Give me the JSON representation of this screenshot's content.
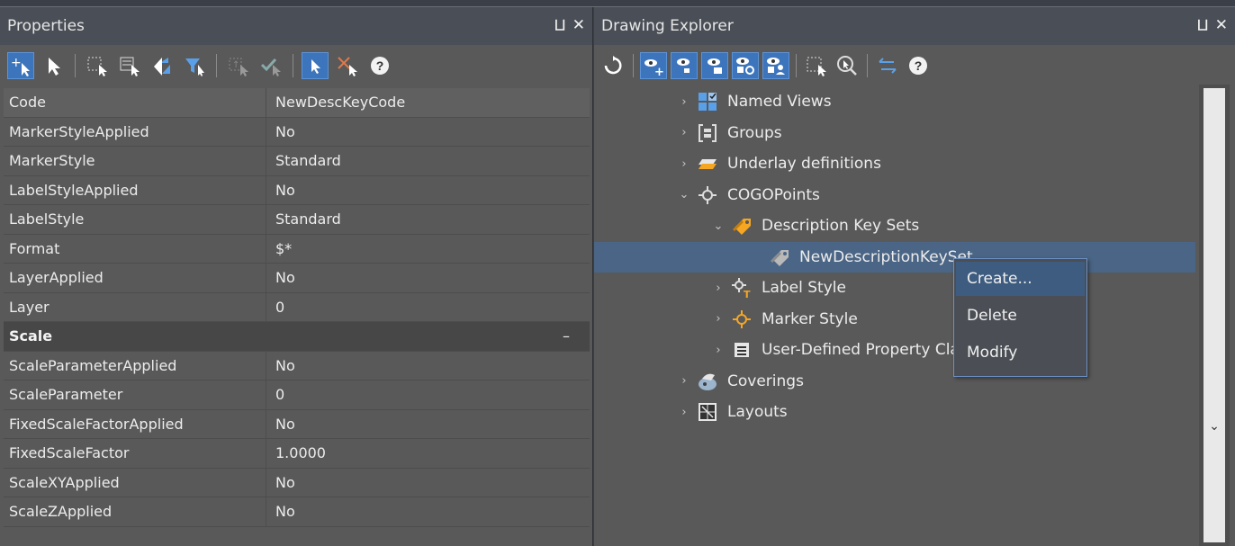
{
  "properties": {
    "title": "Properties",
    "pin_glyph": "⊥",
    "close_glyph": "✕",
    "toolbar_icons": [
      "add-select-icon",
      "pointer-icon",
      "select-window-icon",
      "select-crossing-icon",
      "swap-icon",
      "filter-icon",
      "pick-add-icon",
      "pick-check-icon",
      "select-object-icon",
      "remove-x-icon",
      "help-icon"
    ],
    "rows": [
      {
        "key": "Code",
        "value": "NewDescKeyCode"
      },
      {
        "key": "MarkerStyleApplied",
        "value": "No"
      },
      {
        "key": "MarkerStyle",
        "value": "Standard"
      },
      {
        "key": "LabelStyleApplied",
        "value": "No"
      },
      {
        "key": "LabelStyle",
        "value": "Standard"
      },
      {
        "key": "Format",
        "value": "$*"
      },
      {
        "key": "LayerApplied",
        "value": "No"
      },
      {
        "key": "Layer",
        "value": "0"
      }
    ],
    "section": {
      "label": "Scale",
      "toggle": "–"
    },
    "scale_rows": [
      {
        "key": "ScaleParameterApplied",
        "value": "No"
      },
      {
        "key": "ScaleParameter",
        "value": "0"
      },
      {
        "key": "FixedScaleFactorApplied",
        "value": "No"
      },
      {
        "key": "FixedScaleFactor",
        "value": "1.0000"
      },
      {
        "key": "ScaleXYApplied",
        "value": "No"
      },
      {
        "key": "ScaleZApplied",
        "value": "No"
      }
    ],
    "help_label": "?"
  },
  "explorer": {
    "title": "Drawing Explorer",
    "pin_glyph": "⊥",
    "close_glyph": "✕",
    "help_label": "?",
    "tree": [
      {
        "label": "Named Views",
        "chev": "›",
        "icon": "named-views-icon",
        "indent": 0
      },
      {
        "label": "Groups",
        "chev": "›",
        "icon": "groups-icon",
        "indent": 0
      },
      {
        "label": "Underlay definitions",
        "chev": "›",
        "icon": "underlay-icon",
        "indent": 0
      },
      {
        "label": "COGOPoints",
        "chev": "⌄",
        "icon": "cogo-point-icon",
        "indent": 0
      },
      {
        "label": "Description Key Sets",
        "chev": "⌄",
        "icon": "tag-icon",
        "indent": 1
      },
      {
        "label": "NewDescriptionKeySet",
        "chev": "",
        "icon": "tag-gray-icon",
        "indent": 2
      },
      {
        "label": "Label Style",
        "chev": "›",
        "icon": "label-style-icon",
        "indent": 1
      },
      {
        "label": "Marker Style",
        "chev": "›",
        "icon": "marker-style-icon",
        "indent": 1
      },
      {
        "label": "User-Defined Property Classification",
        "chev": "›",
        "icon": "user-defined-icon",
        "indent": 1
      },
      {
        "label": "Coverings",
        "chev": "›",
        "icon": "coverings-icon",
        "indent": 0
      },
      {
        "label": "Layouts",
        "chev": "›",
        "icon": "layouts-icon",
        "indent": 0
      }
    ],
    "context_menu": [
      {
        "label": "Create..."
      },
      {
        "label": "Delete"
      },
      {
        "label": "Modify"
      }
    ],
    "scroll_arrow": "⌄",
    "colors": {
      "selection": "#4a6585",
      "accent": "#3d75bd",
      "orange_icon": "#f5a623"
    }
  }
}
